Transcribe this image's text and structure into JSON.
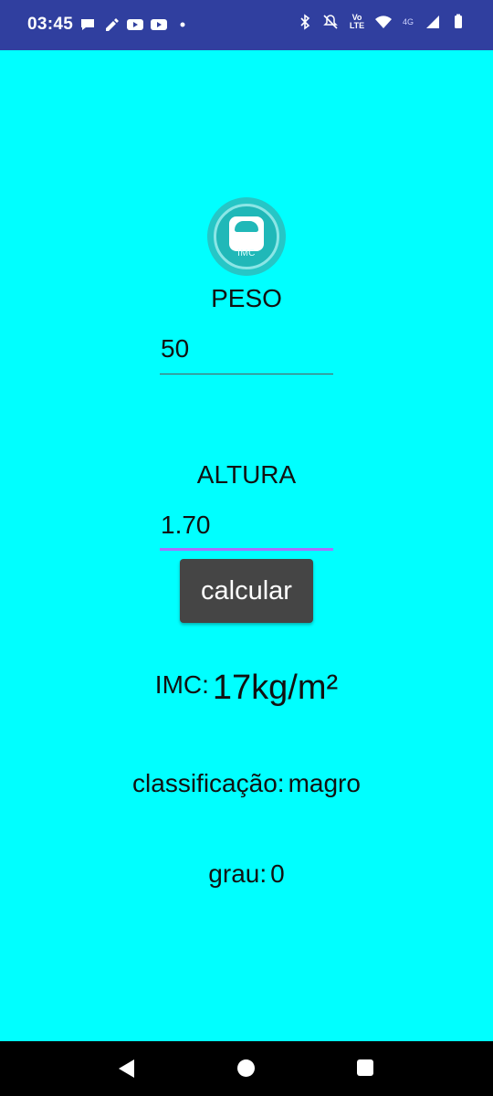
{
  "status_bar": {
    "time": "03:45",
    "lte_top": "Vo",
    "lte_bottom": "LTE",
    "network": "4G"
  },
  "app": {
    "logo_text": "IMC",
    "peso_label": "PESO",
    "peso_value": "50",
    "altura_label": "ALTURA",
    "altura_value": "1.70",
    "calc_button": "calcular",
    "imc_label": "IMC:",
    "imc_value": "17kg/m²",
    "classificacao_label": "classificação:",
    "classificacao_value": "magro",
    "grau_label": "grau:",
    "grau_value": "0"
  },
  "colors": {
    "status_bar": "#303F9F",
    "background": "#00FFFF",
    "button": "#454545",
    "focus_underline": "#E040FB"
  }
}
